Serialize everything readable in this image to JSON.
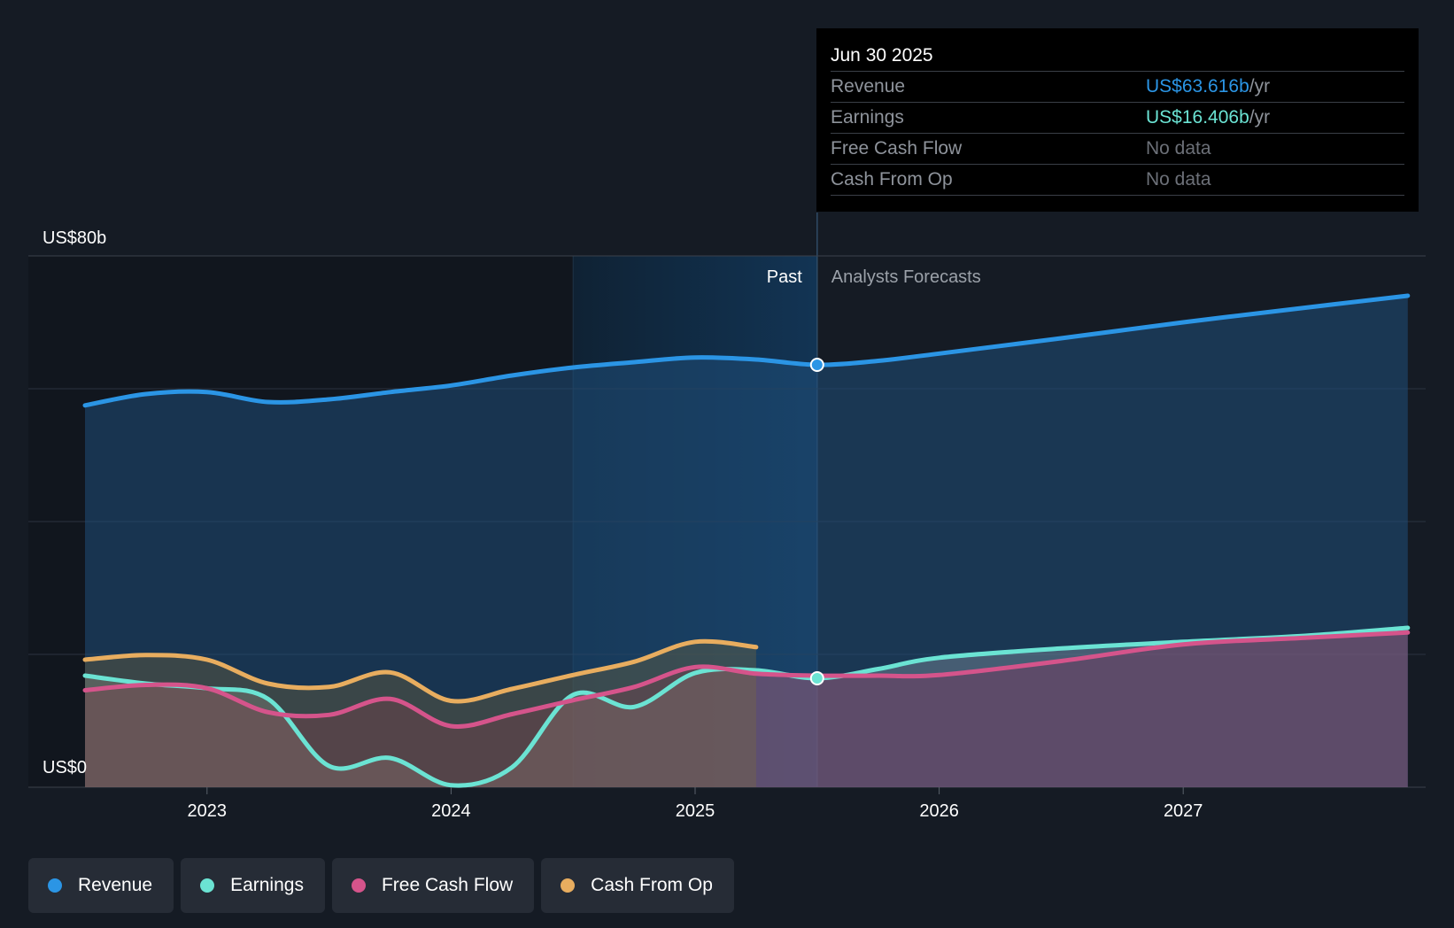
{
  "tooltip": {
    "date": "Jun 30 2025",
    "rows": [
      {
        "name": "Revenue",
        "value": "US$63.616b",
        "unit": " /yr",
        "color": "#2b95e5"
      },
      {
        "name": "Earnings",
        "value": "US$16.406b",
        "unit": " /yr",
        "color": "#6be3d3"
      },
      {
        "name": "Free Cash Flow",
        "value": "No data",
        "unit": "",
        "color": "#6c7078"
      },
      {
        "name": "Cash From Op",
        "value": "No data",
        "unit": "",
        "color": "#6c7078"
      }
    ]
  },
  "legend": [
    {
      "label": "Revenue",
      "color": "#2b95e5"
    },
    {
      "label": "Earnings",
      "color": "#6be3d3"
    },
    {
      "label": "Free Cash Flow",
      "color": "#d5548b"
    },
    {
      "label": "Cash From Op",
      "color": "#e8ad5f"
    }
  ],
  "chart_data": {
    "type": "line",
    "x_axis": {
      "ticks": [
        "2023",
        "2024",
        "2025",
        "2026",
        "2027"
      ],
      "range": [
        2022.5,
        2027.92
      ]
    },
    "y_axis": {
      "labels": [
        "US$80b",
        "US$0"
      ],
      "range": [
        0,
        80
      ],
      "unit": "US$b"
    },
    "regions": {
      "past_label": "Past",
      "forecast_label": "Analysts Forecasts",
      "split_x": 2025.5,
      "highlight_start": 2024.5
    },
    "highlight_date_value": 2025.5,
    "series": [
      {
        "name": "Revenue",
        "color": "#2b95e5",
        "points": [
          [
            2022.5,
            57.5
          ],
          [
            2022.75,
            59.2
          ],
          [
            2023.0,
            59.5
          ],
          [
            2023.25,
            58.0
          ],
          [
            2023.5,
            58.4
          ],
          [
            2023.75,
            59.5
          ],
          [
            2024.0,
            60.5
          ],
          [
            2024.25,
            62.0
          ],
          [
            2024.5,
            63.2
          ],
          [
            2024.75,
            64.0
          ],
          [
            2025.0,
            64.7
          ],
          [
            2025.25,
            64.4
          ],
          [
            2025.5,
            63.6
          ],
          [
            2025.75,
            64.2
          ],
          [
            2026.0,
            65.3
          ],
          [
            2026.5,
            67.6
          ],
          [
            2027.0,
            70.0
          ],
          [
            2027.5,
            72.2
          ],
          [
            2027.92,
            74.0
          ]
        ]
      },
      {
        "name": "Earnings",
        "color": "#6be3d3",
        "points": [
          [
            2022.5,
            16.8
          ],
          [
            2022.75,
            15.6
          ],
          [
            2023.0,
            14.9
          ],
          [
            2023.25,
            13.3
          ],
          [
            2023.5,
            3.2
          ],
          [
            2023.75,
            4.4
          ],
          [
            2024.0,
            0.3
          ],
          [
            2024.25,
            3.0
          ],
          [
            2024.5,
            13.9
          ],
          [
            2024.75,
            12.1
          ],
          [
            2025.0,
            17.2
          ],
          [
            2025.25,
            17.6
          ],
          [
            2025.5,
            16.4
          ],
          [
            2025.75,
            17.8
          ],
          [
            2026.0,
            19.5
          ],
          [
            2026.5,
            20.9
          ],
          [
            2027.0,
            21.9
          ],
          [
            2027.5,
            22.8
          ],
          [
            2027.92,
            24.0
          ]
        ]
      },
      {
        "name": "Free Cash Flow",
        "color": "#d5548b",
        "points": [
          [
            2022.5,
            14.6
          ],
          [
            2022.75,
            15.4
          ],
          [
            2023.0,
            14.9
          ],
          [
            2023.25,
            11.3
          ],
          [
            2023.5,
            10.9
          ],
          [
            2023.75,
            13.3
          ],
          [
            2024.0,
            9.2
          ],
          [
            2024.25,
            11.0
          ],
          [
            2024.5,
            13.1
          ],
          [
            2024.75,
            15.1
          ],
          [
            2025.0,
            18.1
          ],
          [
            2025.25,
            17.1
          ],
          [
            2025.5,
            16.8
          ],
          [
            2025.75,
            16.8
          ],
          [
            2026.0,
            16.9
          ],
          [
            2026.5,
            19.0
          ],
          [
            2027.0,
            21.5
          ],
          [
            2027.5,
            22.5
          ],
          [
            2027.92,
            23.3
          ]
        ]
      },
      {
        "name": "Cash From Op",
        "color": "#e8ad5f",
        "points": [
          [
            2022.5,
            19.2
          ],
          [
            2022.75,
            19.9
          ],
          [
            2023.0,
            19.2
          ],
          [
            2023.25,
            15.6
          ],
          [
            2023.5,
            15.1
          ],
          [
            2023.75,
            17.3
          ],
          [
            2024.0,
            13.0
          ],
          [
            2024.25,
            14.8
          ],
          [
            2024.5,
            16.9
          ],
          [
            2024.75,
            18.9
          ],
          [
            2025.0,
            21.9
          ],
          [
            2025.25,
            21.1
          ]
        ]
      }
    ]
  }
}
